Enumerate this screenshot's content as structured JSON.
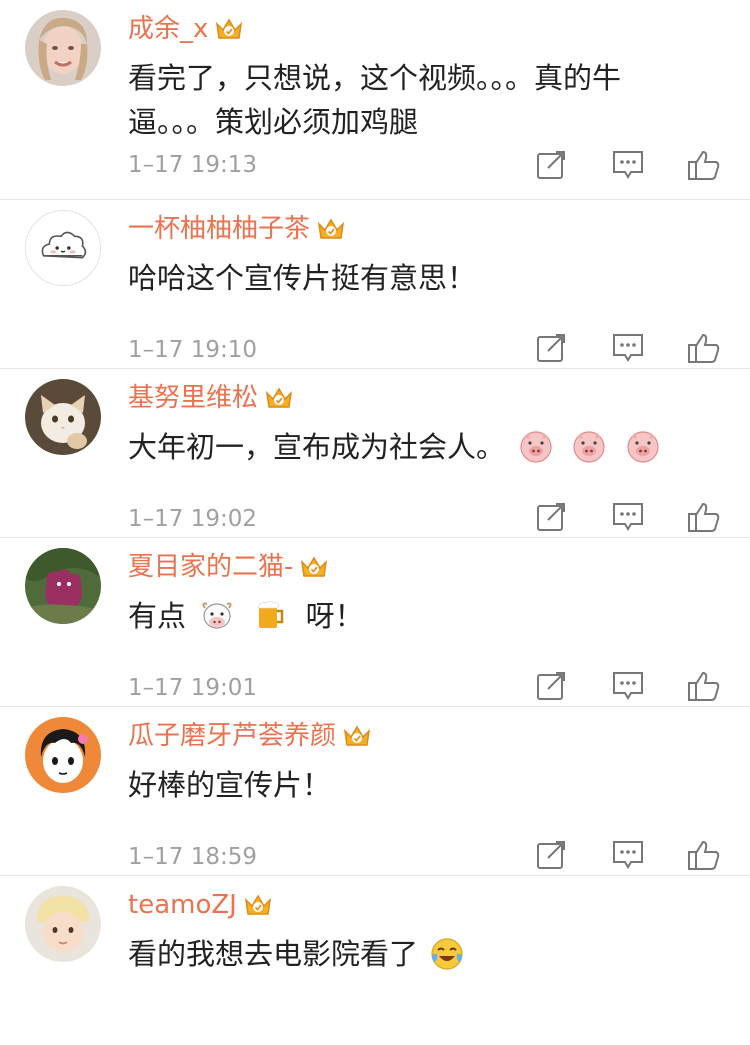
{
  "colors": {
    "username": "#eb7350",
    "text": "#222222",
    "meta": "#a0a0a0",
    "divider": "#e6e6e6",
    "vip_gold": "#f3b023"
  },
  "comments": [
    {
      "username": "成余_x",
      "lines": [
        "看完了，只想说，这个视频。。。真的牛",
        "逼。。。策划必须加鸡腿"
      ],
      "time": "1–17 19:13",
      "avatar": "avatar-woman-photo"
    },
    {
      "username": "一杯柚柚柚子茶",
      "lines": [
        "哈哈这个宣传片挺有意思！"
      ],
      "time": "1–17 19:10",
      "avatar": "avatar-cloud-cartoon"
    },
    {
      "username": "基努里维松",
      "lines": [
        "大年初一，宣布成为社会人。"
      ],
      "time": "1–17 19:02",
      "avatar": "avatar-cat-photo",
      "emoji": [
        "pig-face-emoji",
        "pig-face-emoji",
        "pig-face-emoji"
      ]
    },
    {
      "username": "夏目家的二猫-",
      "text_before": "有点",
      "text_after": "呀！",
      "time": "1–17 19:01",
      "avatar": "avatar-cartoon-plant",
      "emoji": [
        "cow-face-emoji",
        "beer-mug-emoji"
      ]
    },
    {
      "username": "瓜子磨牙芦荟养颜",
      "lines": [
        "好棒的宣传片！"
      ],
      "time": "1–17 18:59",
      "avatar": "avatar-anime-boy"
    },
    {
      "username": "teamoZJ",
      "lines": [
        "看的我想去电影院看了"
      ],
      "time": "",
      "avatar": "avatar-baby-photo",
      "emoji": [
        "crying-laughing-emoji"
      ]
    }
  ],
  "icons": {
    "vip": "crown-vip-icon",
    "share": "share-icon",
    "reply": "comment-icon",
    "like": "thumbs-up-icon"
  }
}
